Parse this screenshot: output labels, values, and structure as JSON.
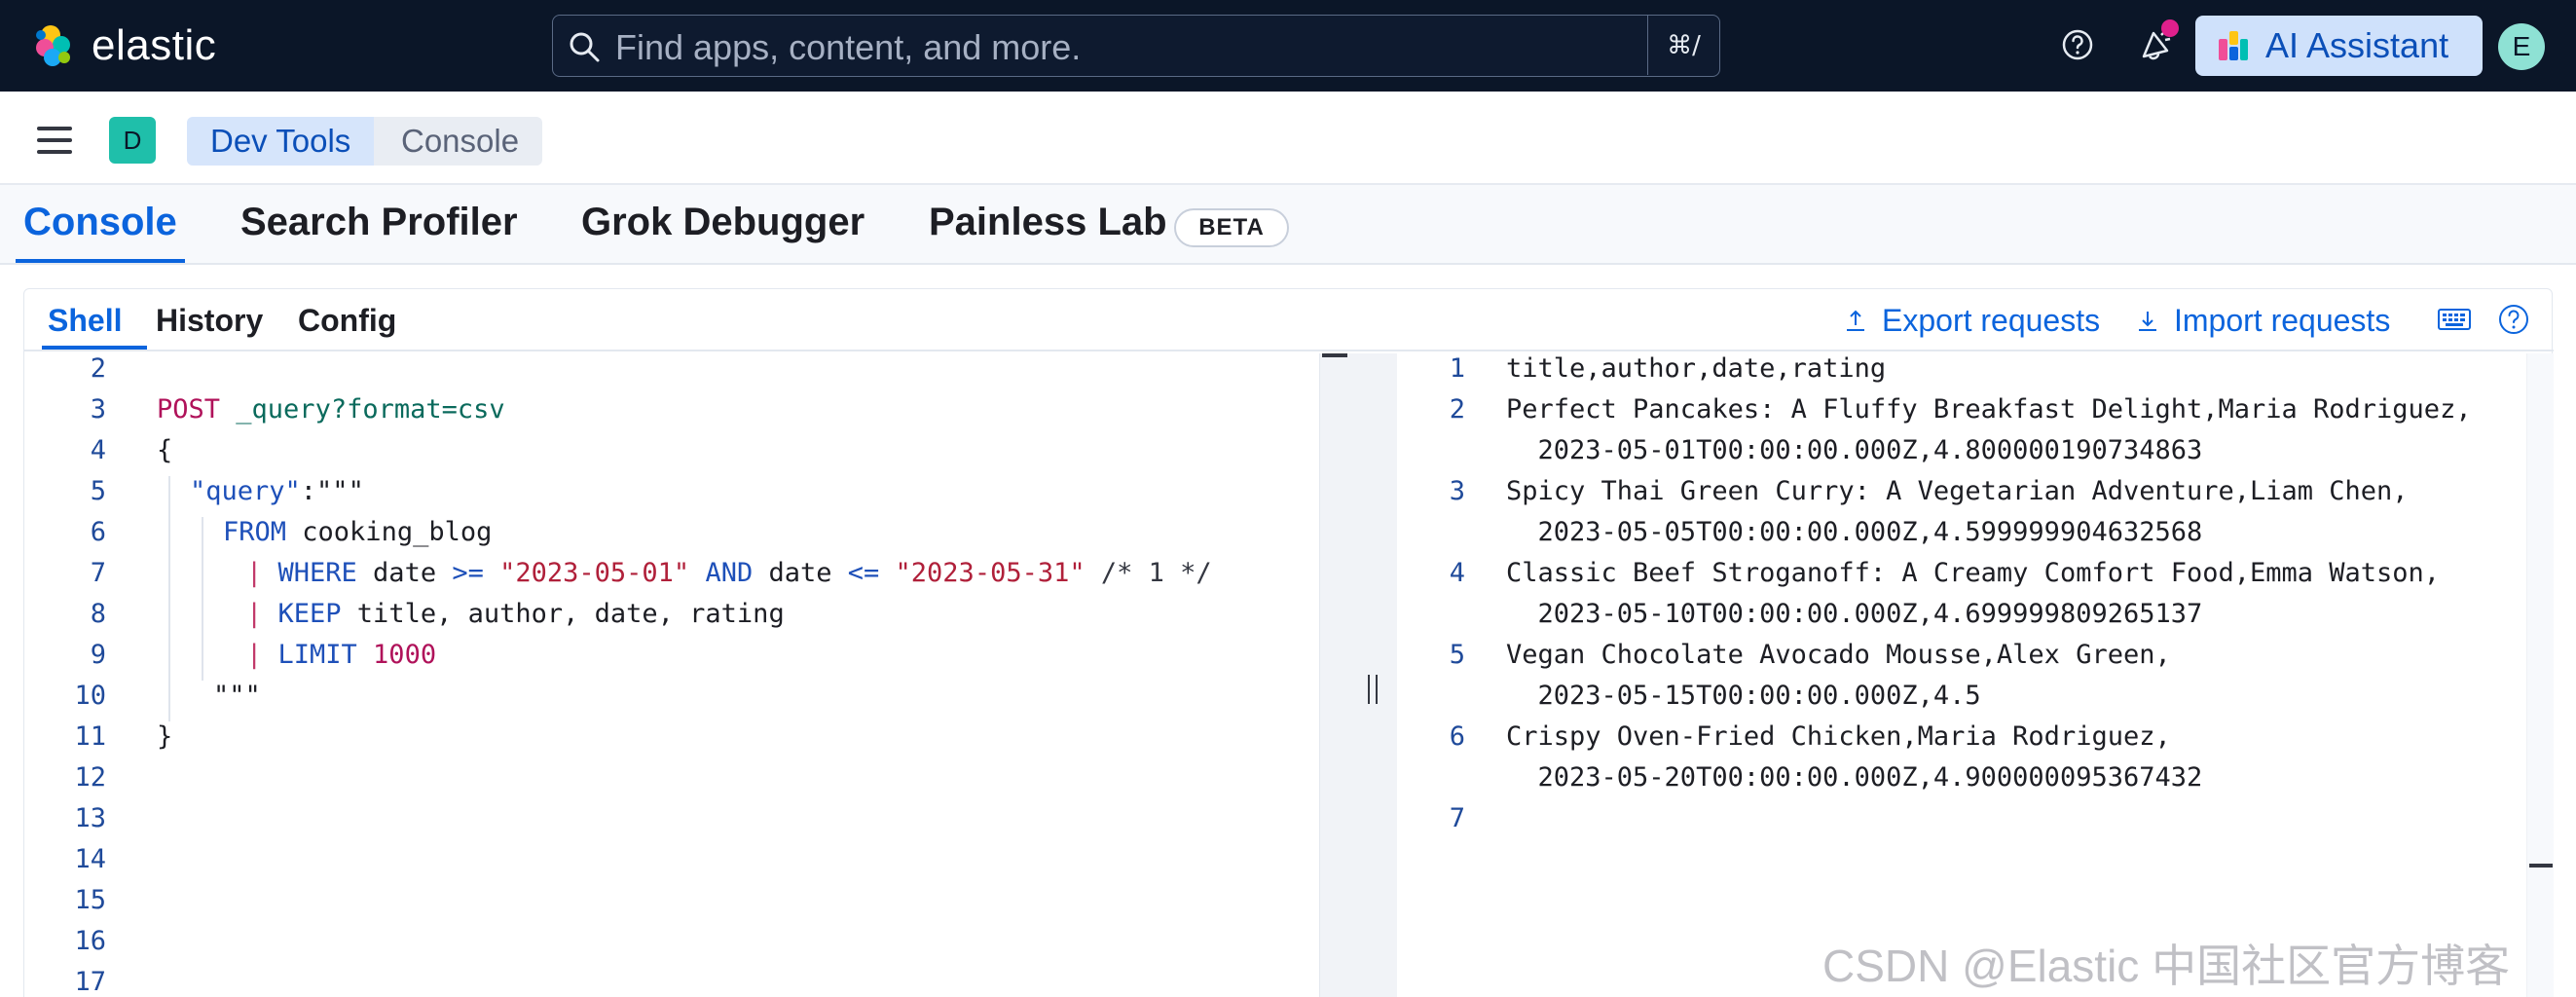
{
  "header": {
    "brand": "elastic",
    "search_placeholder": "Find apps, content, and more.",
    "search_shortcut": "⌘/",
    "ai_assistant_label": "AI Assistant",
    "user_initial": "E",
    "colors": {
      "header_bg": "#0b1628",
      "accent": "#0b64dd"
    }
  },
  "breadcrumbs": {
    "space_initial": "D",
    "items": [
      "Dev Tools",
      "Console"
    ]
  },
  "app_tabs": {
    "items": [
      "Console",
      "Search Profiler",
      "Grok Debugger",
      "Painless Lab"
    ],
    "active": "Console",
    "beta_badge": "BETA"
  },
  "console": {
    "tabs": [
      "Shell",
      "History",
      "Config"
    ],
    "active_tab": "Shell",
    "export_label": "Export requests",
    "import_label": "Import requests"
  },
  "editor": {
    "line_numbers": [
      "2",
      "3",
      "4",
      "5",
      "6",
      "7",
      "8",
      "9",
      "10",
      "11",
      "12",
      "13",
      "14",
      "15",
      "16",
      "17"
    ],
    "lines": {
      "l3_method": "POST",
      "l3_path": " _query?format=csv",
      "l4": "{",
      "l5_key": "\"query\"",
      "l5_rest": ":\"\"\"",
      "l6_kw": "FROM",
      "l6_rest": " cooking_blog",
      "l7_pipe": "| ",
      "l7_kw": "WHERE",
      "l7_a": " date ",
      "l7_op1": ">=",
      "l7_s1": " \"2023-05-01\"",
      "l7_and": " AND",
      "l7_b": " date ",
      "l7_op2": "<=",
      "l7_s2": " \"2023-05-31\"",
      "l7_cmt": " /* 1 */",
      "l8_pipe": "| ",
      "l8_kw": "KEEP",
      "l8_rest": " title, author, date, rating",
      "l9_pipe": "| ",
      "l9_kw": "LIMIT",
      "l9_num": " 1000",
      "l10": "\"\"\"",
      "l11": "}"
    }
  },
  "output": {
    "line_numbers": [
      "1",
      "2",
      "3",
      "4",
      "5",
      "6",
      "7"
    ],
    "rows": [
      "title,author,date,rating",
      "Perfect Pancakes: A Fluffy Breakfast Delight,Maria Rodriguez,",
      "  2023-05-01T00:00:00.000Z,4.800000190734863",
      "Spicy Thai Green Curry: A Vegetarian Adventure,Liam Chen,",
      "  2023-05-05T00:00:00.000Z,4.599999904632568",
      "Classic Beef Stroganoff: A Creamy Comfort Food,Emma Watson,",
      "  2023-05-10T00:00:00.000Z,4.699999809265137",
      "Vegan Chocolate Avocado Mousse,Alex Green,",
      "  2023-05-15T00:00:00.000Z,4.5",
      "Crispy Oven-Fried Chicken,Maria Rodriguez,",
      "  2023-05-20T00:00:00.000Z,4.900000095367432"
    ]
  },
  "watermark": "CSDN @Elastic 中国社区官方博客"
}
